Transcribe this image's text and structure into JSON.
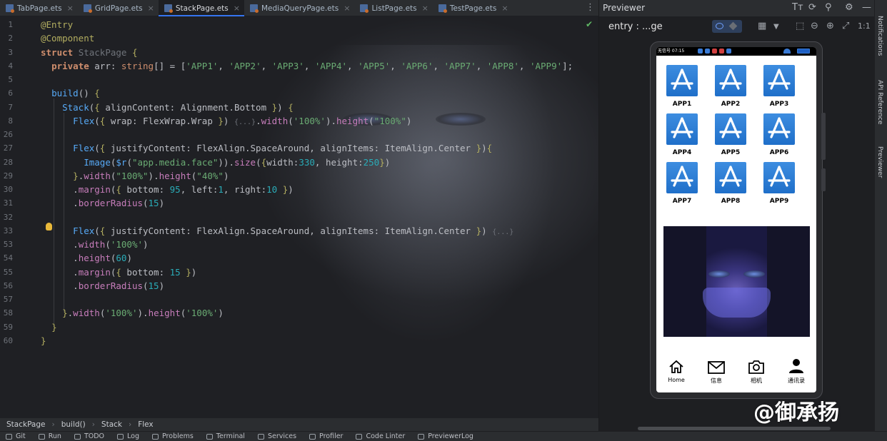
{
  "tabs": [
    {
      "label": "TabPage.ets",
      "active": false
    },
    {
      "label": "GridPage.ets",
      "active": false
    },
    {
      "label": "StackPage.ets",
      "active": true
    },
    {
      "label": "MediaQueryPage.ets",
      "active": false
    },
    {
      "label": "ListPage.ets",
      "active": false
    },
    {
      "label": "TestPage.ets",
      "active": false
    }
  ],
  "tab_close_glyph": "×",
  "tab_menu_glyph": "⋮",
  "code_lines": [
    {
      "n": "1",
      "html": "<span class='a'>@Entry</span>"
    },
    {
      "n": "2",
      "html": "<span class='a'>@Component</span>"
    },
    {
      "n": "3",
      "html": "<span class='k'>struct</span> <span class='g'>StackPage</span> <span class='a'>{</span>"
    },
    {
      "n": "4",
      "html": "  <span class='k'>private</span> arr: <span class='ty'>string</span>[] = [<span class='s'>'APP1'</span>, <span class='s'>'APP2'</span>, <span class='s'>'APP3'</span>, <span class='s'>'APP4'</span>, <span class='s'>'APP5'</span>, <span class='s'>'APP6'</span>, <span class='s'>'APP7'</span>, <span class='s'>'APP8'</span>, <span class='s'>'APP9'</span>];"
    },
    {
      "n": "5",
      "html": ""
    },
    {
      "n": "6",
      "html": "  <span class='f'>build</span>() <span class='a'>{</span>"
    },
    {
      "n": "7",
      "html": "    <span class='f'>Stack</span>(<span class='a'>{</span> alignContent: Alignment.Bottom <span class='a'>}</span>) <span class='a'>{</span>"
    },
    {
      "n": "8",
      "html": "      <span class='f'>Flex</span>(<span class='a'>{</span> wrap: FlexWrap.Wrap <span class='a'>}</span>) <span class='fold'>{...}</span>.<span class='p'>width</span>(<span class='s'>'100%'</span>).<span class='p'>height</span>(<span class='s'>\"100%\"</span>)"
    },
    {
      "n": "26",
      "html": ""
    },
    {
      "n": "27",
      "html": "      <span class='f'>Flex</span>(<span class='a'>{</span> justifyContent: FlexAlign.SpaceAround, alignItems: ItemAlign.Center <span class='a'>}</span>)<span class='a'>{</span>"
    },
    {
      "n": "28",
      "html": "        <span class='f'>Image</span>(<span class='f'>$r</span>(<span class='s'>\"app.media.face\"</span>)).<span class='p'>size</span>(<span class='a'>{</span>width:<span class='n'>330</span>, height:<span class='n'>250</span><span class='a'>}</span>)"
    },
    {
      "n": "29",
      "html": "      <span class='a'>}</span>.<span class='p'>width</span>(<span class='s'>\"100%\"</span>).<span class='p'>height</span>(<span class='s'>\"40%\"</span>)"
    },
    {
      "n": "30",
      "html": "      .<span class='p'>margin</span>(<span class='a'>{</span> bottom: <span class='n'>95</span>, left:<span class='n'>1</span>, right:<span class='n'>10</span> <span class='a'>}</span>)"
    },
    {
      "n": "31",
      "html": "      .<span class='p'>borderRadius</span>(<span class='n'>15</span>)"
    },
    {
      "n": "32",
      "html": ""
    },
    {
      "n": "33",
      "html": "      <span class='f'>Flex</span>(<span class='a'>{</span> justifyContent: FlexAlign.SpaceAround, alignItems: ItemAlign.Center <span class='a'>}</span>) <span class='fold'>{...}</span>"
    },
    {
      "n": "53",
      "html": "      .<span class='p'>width</span>(<span class='s'>'100%'</span>)"
    },
    {
      "n": "54",
      "html": "      .<span class='p'>height</span>(<span class='n'>60</span>)"
    },
    {
      "n": "55",
      "html": "      .<span class='p'>margin</span>(<span class='a'>{</span> bottom: <span class='n'>15</span> <span class='a'>}</span>)"
    },
    {
      "n": "56",
      "html": "      .<span class='p'>borderRadius</span>(<span class='n'>15</span>)"
    },
    {
      "n": "57",
      "html": ""
    },
    {
      "n": "58",
      "html": "    <span class='a'>}</span>.<span class='p'>width</span>(<span class='s'>'100%'</span>).<span class='p'>height</span>(<span class='s'>'100%'</span>)"
    },
    {
      "n": "59",
      "html": "  <span class='a'>}</span>"
    },
    {
      "n": "60",
      "html": "<span class='a'>}</span>"
    }
  ],
  "breadcrumbs": [
    "StackPage",
    "build()",
    "Stack",
    "Flex"
  ],
  "breadcrumb_sep": "›",
  "bottom_tools": [
    "Git",
    "Run",
    "TODO",
    "Log",
    "Problems",
    "Terminal",
    "Services",
    "Profiler",
    "Code Linter",
    "PreviewerLog"
  ],
  "previewer": {
    "title": "Previewer",
    "entry": "entry : ...ge",
    "tool_glyphs": {
      "font": "Tт",
      "rotate": "⟳",
      "pin": "⚲",
      "gear": "⚙",
      "minimize": "—"
    },
    "zoom_glyphs": {
      "frame": "⬚",
      "zoom_out": "⊖",
      "zoom_in": "⊕",
      "fit": "⤢",
      "actual": "1:1"
    }
  },
  "device": {
    "status_left": "无信号  07:15",
    "apps": [
      "APP1",
      "APP2",
      "APP3",
      "APP4",
      "APP5",
      "APP6",
      "APP7",
      "APP8",
      "APP9"
    ],
    "nav": [
      {
        "label": "Home",
        "icon": "home-icon"
      },
      {
        "label": "信息",
        "icon": "mail-icon"
      },
      {
        "label": "相机",
        "icon": "camera-icon"
      },
      {
        "label": "通讯录",
        "icon": "contacts-icon"
      }
    ]
  },
  "watermark": "@御承扬",
  "right_strip": [
    "Notifications",
    "API Reference",
    "Previewer"
  ],
  "colors": {
    "accent": "#3574f0",
    "app_icon": "#2a7fd6",
    "check": "#5fb865"
  }
}
